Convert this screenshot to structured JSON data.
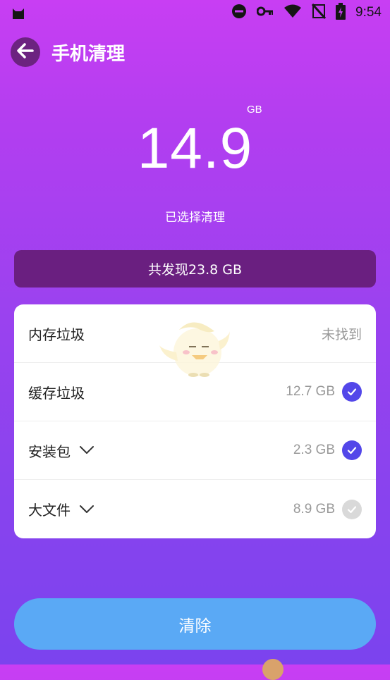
{
  "status_bar": {
    "time": "9:54",
    "icons": [
      "cat-icon",
      "dnd-icon",
      "key-icon",
      "wifi-icon",
      "no-signal-icon",
      "battery-icon"
    ]
  },
  "header": {
    "title": "手机清理",
    "back_icon": "arrow-left-icon"
  },
  "summary": {
    "value": "14.9",
    "unit": "GB",
    "caption": "已选择清理"
  },
  "found_banner": {
    "text": "共发现23.8 GB"
  },
  "items": [
    {
      "label": "内存垃圾",
      "size": "",
      "status": "未找到",
      "has_chevron": false,
      "checked": null
    },
    {
      "label": "缓存垃圾",
      "size": "12.7 GB",
      "status": "",
      "has_chevron": false,
      "checked": true
    },
    {
      "label": "安装包",
      "size": "2.3 GB",
      "status": "",
      "has_chevron": true,
      "checked": true
    },
    {
      "label": "大文件",
      "size": "8.9 GB",
      "status": "",
      "has_chevron": true,
      "checked": false
    }
  ],
  "actions": {
    "clear_label": "清除"
  },
  "colors": {
    "check_on": "#5347e9",
    "check_off": "#d9d9d9",
    "clear_button": "#5aa9f5",
    "banner": "#6a1f80"
  }
}
